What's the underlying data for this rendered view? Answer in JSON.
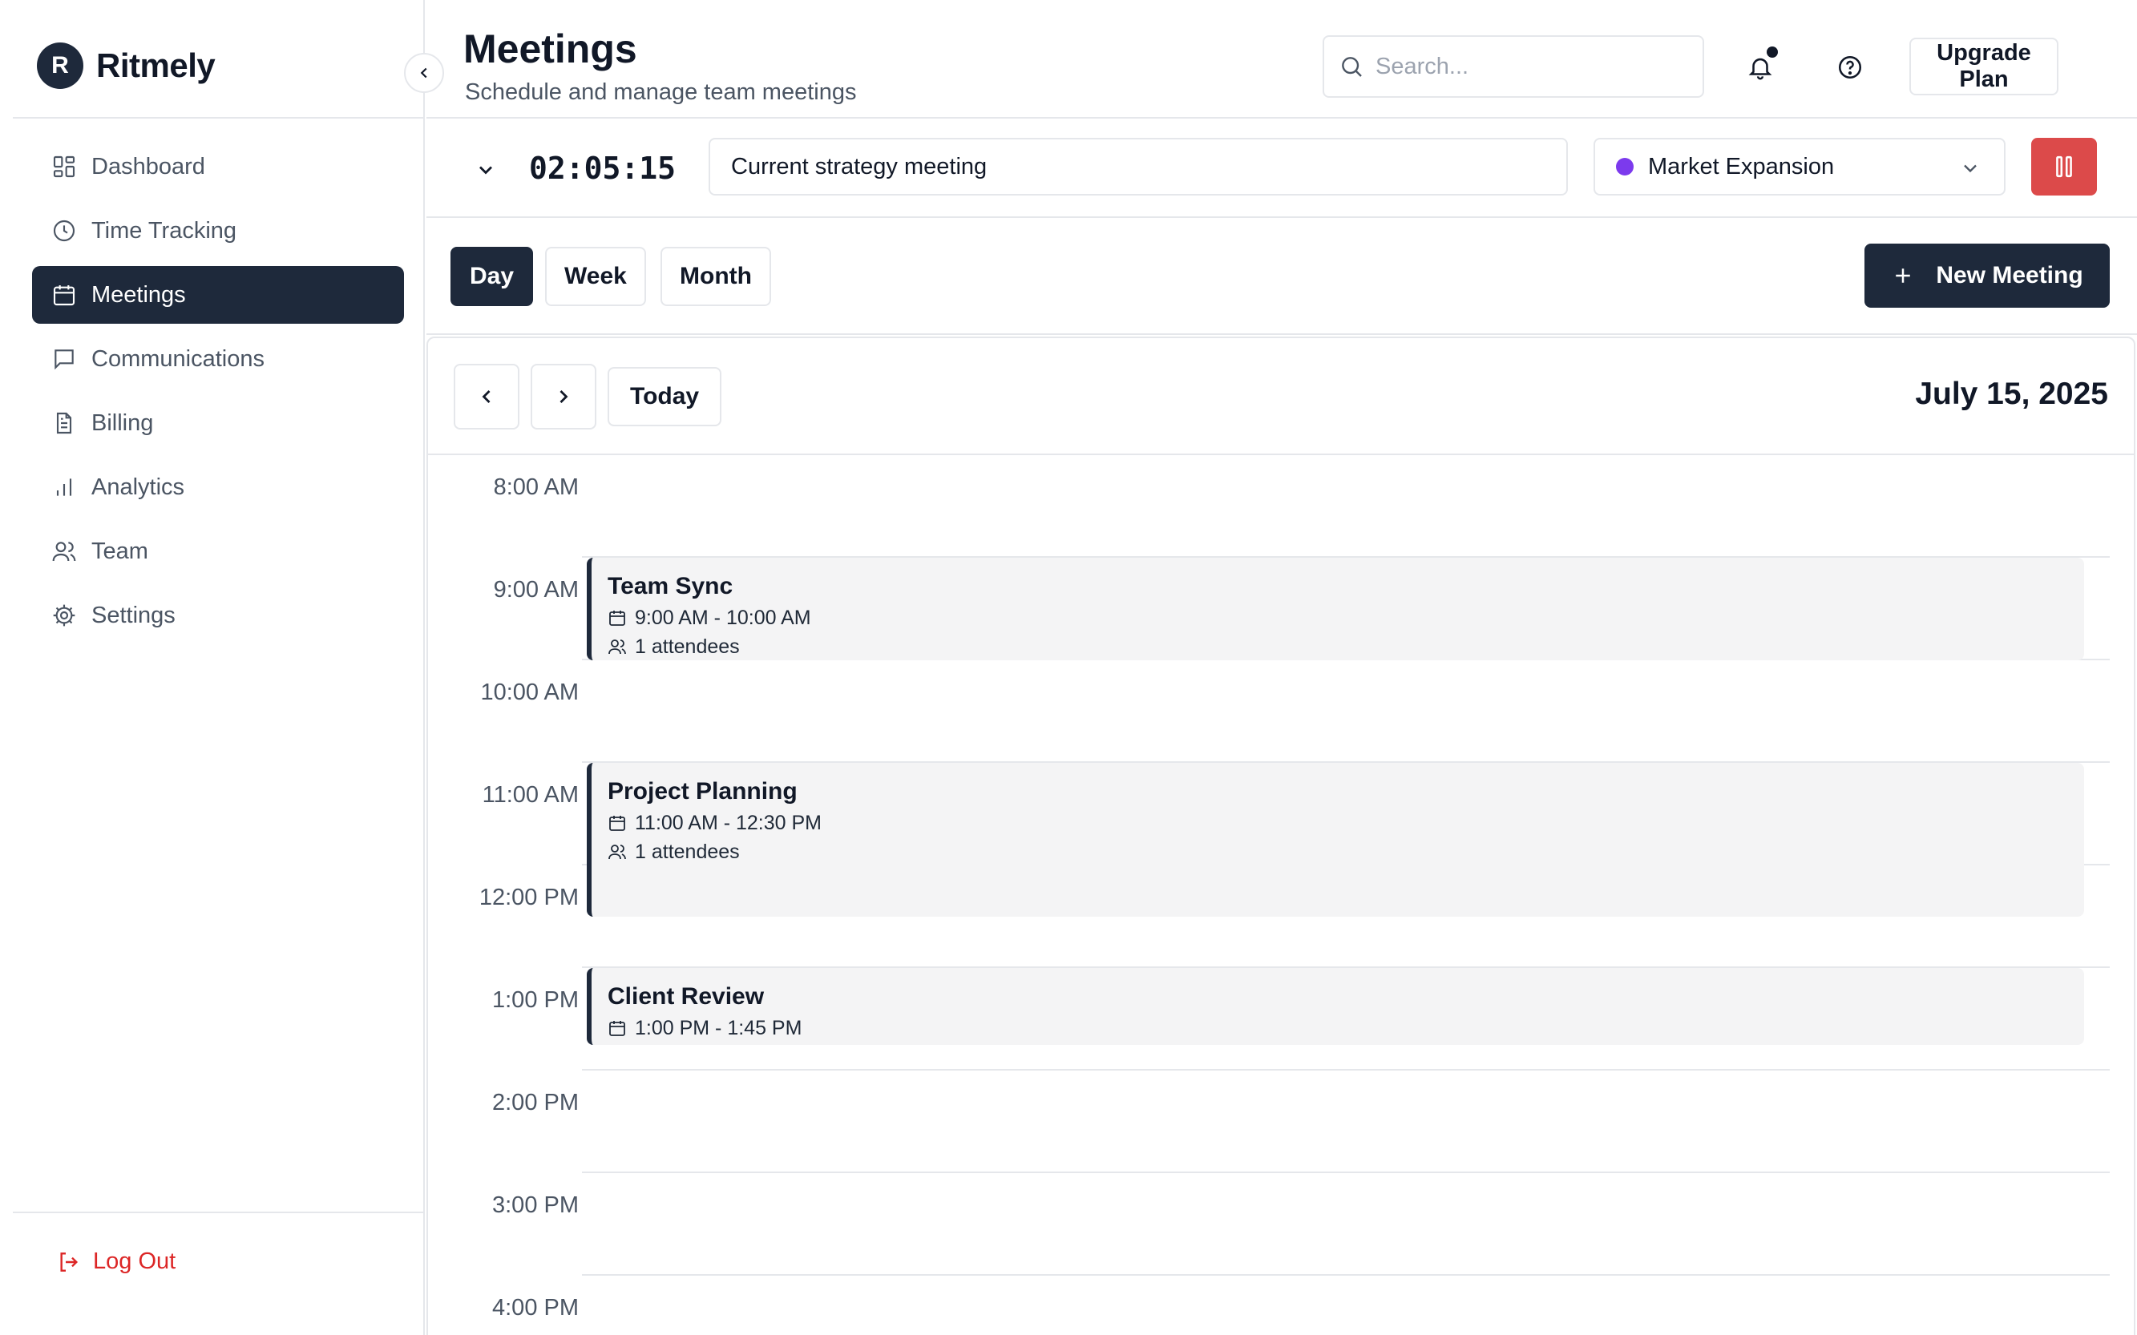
{
  "app": {
    "brand_initial": "R",
    "brand_name": "Ritmely"
  },
  "sidebar": {
    "items": [
      {
        "label": "Dashboard",
        "icon": "dashboard-icon",
        "active": false
      },
      {
        "label": "Time Tracking",
        "icon": "clock-icon",
        "active": false
      },
      {
        "label": "Meetings",
        "icon": "calendar-icon",
        "active": true
      },
      {
        "label": "Communications",
        "icon": "message-icon",
        "active": false
      },
      {
        "label": "Billing",
        "icon": "document-icon",
        "active": false
      },
      {
        "label": "Analytics",
        "icon": "bar-chart-icon",
        "active": false
      },
      {
        "label": "Team",
        "icon": "users-icon",
        "active": false
      },
      {
        "label": "Settings",
        "icon": "gear-icon",
        "active": false
      }
    ],
    "logout_label": "Log Out"
  },
  "header": {
    "title": "Meetings",
    "subtitle": "Schedule and manage team meetings",
    "search_placeholder": "Search...",
    "upgrade_label": "Upgrade Plan"
  },
  "timer": {
    "elapsed": "02:05:15",
    "description": "Current strategy meeting",
    "project": "Market Expansion",
    "project_color": "#7c3aed",
    "stop_color": "#dc4a4a"
  },
  "views": {
    "tabs": [
      {
        "label": "Day",
        "active": true
      },
      {
        "label": "Week",
        "active": false
      },
      {
        "label": "Month",
        "active": false
      }
    ],
    "new_meeting_label": "New Meeting"
  },
  "calendar": {
    "today_label": "Today",
    "date": "July 15, 2025",
    "hours": [
      "8:00 AM",
      "9:00 AM",
      "10:00 AM",
      "11:00 AM",
      "12:00 PM",
      "1:00 PM",
      "2:00 PM",
      "3:00 PM",
      "4:00 PM"
    ],
    "events": [
      {
        "title": "Team Sync",
        "time": "9:00 AM - 10:00 AM",
        "attendees": "1 attendees"
      },
      {
        "title": "Project Planning",
        "time": "11:00 AM - 12:30 PM",
        "attendees": "1 attendees"
      },
      {
        "title": "Client Review",
        "time": "1:00 PM - 1:45 PM",
        "attendees": ""
      }
    ]
  },
  "colors": {
    "primary": "#1e293b",
    "danger": "#dc2626",
    "border": "#e5e7eb"
  }
}
